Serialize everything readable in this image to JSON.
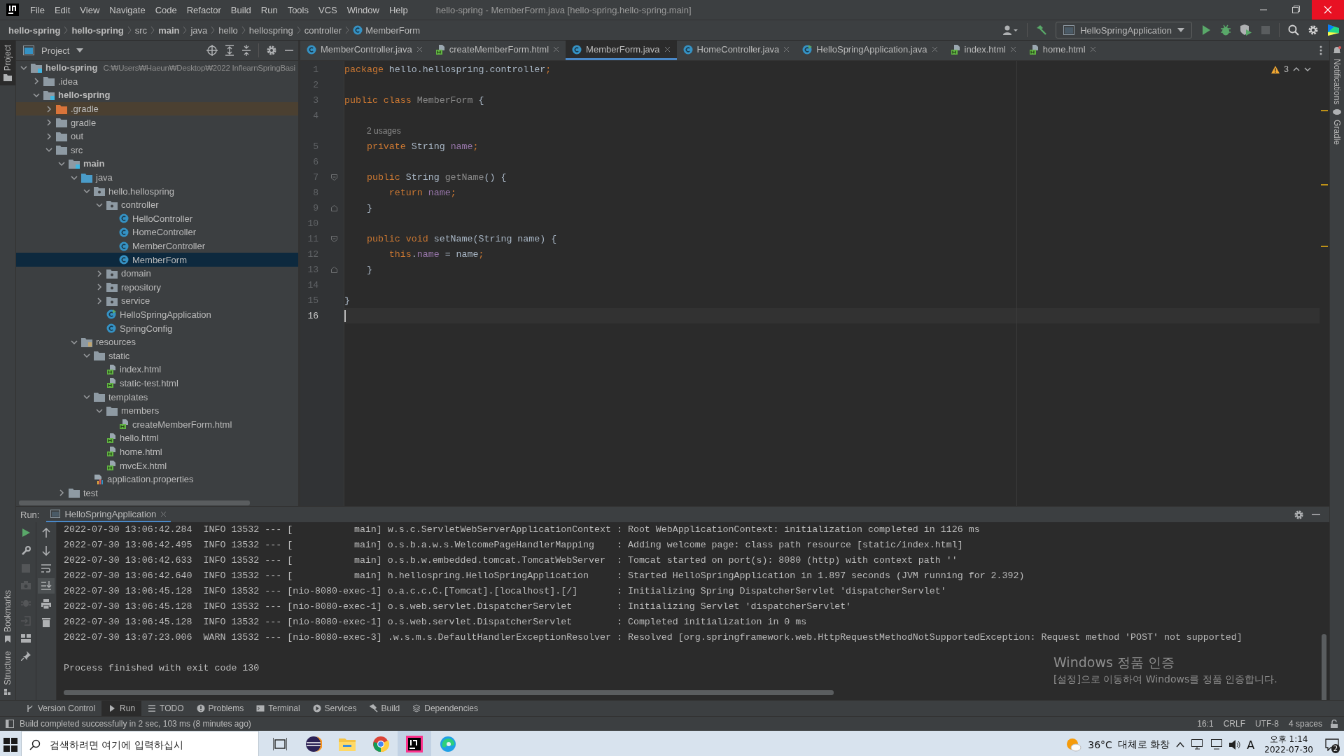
{
  "window": {
    "title": "hello-spring - MemberForm.java [hello-spring.hello-spring.main]",
    "menu": [
      "File",
      "Edit",
      "View",
      "Navigate",
      "Code",
      "Refactor",
      "Build",
      "Run",
      "Tools",
      "VCS",
      "Window",
      "Help"
    ]
  },
  "breadcrumbs": [
    {
      "label": "hello-spring",
      "bold": true,
      "kind": "plain"
    },
    {
      "label": "hello-spring",
      "bold": true,
      "kind": "plain"
    },
    {
      "label": "src",
      "bold": false,
      "kind": "plain"
    },
    {
      "label": "main",
      "bold": true,
      "kind": "plain"
    },
    {
      "label": "java",
      "bold": false,
      "kind": "plain"
    },
    {
      "label": "hello",
      "bold": false,
      "kind": "plain"
    },
    {
      "label": "hellospring",
      "bold": false,
      "kind": "plain"
    },
    {
      "label": "controller",
      "bold": false,
      "kind": "plain"
    },
    {
      "label": "MemberForm",
      "bold": false,
      "kind": "class"
    }
  ],
  "run_config": "HelloSpringApplication",
  "left_stripe": {
    "top": [
      {
        "label": "Project",
        "selected": true
      }
    ],
    "bottom": [
      {
        "label": "Bookmarks",
        "selected": false
      },
      {
        "label": "Structure",
        "selected": false
      }
    ]
  },
  "right_stripe": [
    "Notifications",
    "Gradle"
  ],
  "project_panel": {
    "title": "Project",
    "tree": [
      {
        "label": "hello-spring",
        "path": "C:₩Users₩Haeun₩Desktop₩2022 InflearnSpringBasi",
        "kind": "module",
        "bold": true,
        "expanded": true,
        "selected": false,
        "children": [
          {
            "label": ".idea",
            "kind": "folder",
            "expanded": false,
            "selected": false
          },
          {
            "label": "hello-spring",
            "kind": "module",
            "bold": true,
            "expanded": true,
            "selected": false,
            "children": [
              {
                "label": ".gradle",
                "kind": "excluded",
                "expanded": false,
                "selected": false
              },
              {
                "label": "gradle",
                "kind": "folder",
                "expanded": false,
                "selected": false
              },
              {
                "label": "out",
                "kind": "folder",
                "expanded": false,
                "selected": false
              },
              {
                "label": "src",
                "kind": "folder",
                "expanded": true,
                "selected": false,
                "children": [
                  {
                    "label": "main",
                    "kind": "module",
                    "bold": true,
                    "expanded": true,
                    "selected": false,
                    "children": [
                      {
                        "label": "java",
                        "kind": "source",
                        "expanded": true,
                        "selected": false,
                        "children": [
                          {
                            "label": "hello.hellospring",
                            "kind": "package",
                            "expanded": true,
                            "selected": false,
                            "children": [
                              {
                                "label": "controller",
                                "kind": "package",
                                "expanded": true,
                                "selected": false,
                                "children": [
                                  {
                                    "label": "HelloController",
                                    "kind": "class",
                                    "selected": false
                                  },
                                  {
                                    "label": "HomeController",
                                    "kind": "class",
                                    "selected": false
                                  },
                                  {
                                    "label": "MemberController",
                                    "kind": "class",
                                    "selected": false
                                  },
                                  {
                                    "label": "MemberForm",
                                    "kind": "class",
                                    "selected": true
                                  }
                                ]
                              },
                              {
                                "label": "domain",
                                "kind": "package",
                                "expanded": false,
                                "selected": false
                              },
                              {
                                "label": "repository",
                                "kind": "package",
                                "expanded": false,
                                "selected": false
                              },
                              {
                                "label": "service",
                                "kind": "package",
                                "expanded": false,
                                "selected": false
                              },
                              {
                                "label": "HelloSpringApplication",
                                "kind": "app",
                                "selected": false
                              },
                              {
                                "label": "SpringConfig",
                                "kind": "class",
                                "selected": false
                              }
                            ]
                          }
                        ]
                      },
                      {
                        "label": "resources",
                        "kind": "resources",
                        "expanded": true,
                        "selected": false,
                        "children": [
                          {
                            "label": "static",
                            "kind": "folder",
                            "expanded": true,
                            "selected": false,
                            "children": [
                              {
                                "label": "index.html",
                                "kind": "html",
                                "selected": false
                              },
                              {
                                "label": "static-test.html",
                                "kind": "html",
                                "selected": false
                              }
                            ]
                          },
                          {
                            "label": "templates",
                            "kind": "folder",
                            "expanded": true,
                            "selected": false,
                            "children": [
                              {
                                "label": "members",
                                "kind": "folder",
                                "expanded": true,
                                "selected": false,
                                "children": [
                                  {
                                    "label": "createMemberForm.html",
                                    "kind": "html",
                                    "selected": false
                                  }
                                ]
                              },
                              {
                                "label": "hello.html",
                                "kind": "html",
                                "selected": false
                              },
                              {
                                "label": "home.html",
                                "kind": "html",
                                "selected": false
                              },
                              {
                                "label": "mvcEx.html",
                                "kind": "html",
                                "selected": false
                              }
                            ]
                          },
                          {
                            "label": "application.properties",
                            "kind": "properties",
                            "selected": false
                          }
                        ]
                      }
                    ]
                  },
                  {
                    "label": "test",
                    "kind": "folder",
                    "expanded": false,
                    "selected": false
                  }
                ]
              }
            ]
          }
        ]
      }
    ]
  },
  "editor": {
    "tabs": [
      {
        "label": "MemberController.java",
        "kind": "class",
        "selected": false
      },
      {
        "label": "createMemberForm.html",
        "kind": "html",
        "selected": false
      },
      {
        "label": "MemberForm.java",
        "kind": "class",
        "selected": true
      },
      {
        "label": "HomeController.java",
        "kind": "class",
        "selected": false
      },
      {
        "label": "HelloSpringApplication.java",
        "kind": "app",
        "selected": false
      },
      {
        "label": "index.html",
        "kind": "html",
        "selected": false
      },
      {
        "label": "home.html",
        "kind": "html",
        "selected": false
      }
    ],
    "warnings": "3",
    "lines": [
      {
        "kind": "code",
        "number": "1",
        "current": false,
        "tokens": [
          {
            "kind": "kw",
            "text": "package"
          },
          {
            "kind": "plain",
            "text": " hello.hellospring.controller"
          },
          {
            "kind": "kw",
            "text": ";"
          }
        ]
      },
      {
        "kind": "code",
        "number": "2",
        "current": false
      },
      {
        "kind": "code",
        "number": "3",
        "current": false,
        "tokens": [
          {
            "kind": "kw",
            "text": "public class "
          },
          {
            "kind": "unused",
            "text": "MemberForm"
          },
          {
            "kind": "plain",
            "text": " {"
          }
        ]
      },
      {
        "kind": "code",
        "number": "4",
        "current": false
      },
      {
        "kind": "hint",
        "text": "2 usages"
      },
      {
        "kind": "code",
        "number": "5",
        "current": false,
        "tokens": [
          {
            "kind": "kw",
            "text": "    private "
          },
          {
            "kind": "plain",
            "text": "String "
          },
          {
            "kind": "field",
            "text": "name"
          },
          {
            "kind": "kw",
            "text": ";"
          }
        ]
      },
      {
        "kind": "code",
        "number": "6",
        "current": false
      },
      {
        "kind": "code",
        "number": "7",
        "current": false,
        "fold_start": true,
        "tokens": [
          {
            "kind": "kw",
            "text": "    public "
          },
          {
            "kind": "plain",
            "text": "String "
          },
          {
            "kind": "unused",
            "text": "getName"
          },
          {
            "kind": "plain",
            "text": "() {"
          }
        ]
      },
      {
        "kind": "code",
        "number": "8",
        "current": false,
        "tokens": [
          {
            "kind": "kw",
            "text": "        return "
          },
          {
            "kind": "field",
            "text": "name"
          },
          {
            "kind": "kw",
            "text": ";"
          }
        ]
      },
      {
        "kind": "code",
        "number": "9",
        "current": false,
        "fold_end": true,
        "tokens": [
          {
            "kind": "plain",
            "text": "    }"
          }
        ]
      },
      {
        "kind": "code",
        "number": "10",
        "current": false
      },
      {
        "kind": "code",
        "number": "11",
        "current": false,
        "fold_start": true,
        "tokens": [
          {
            "kind": "kw",
            "text": "    public void "
          },
          {
            "kind": "plain",
            "text": "setName(String name) {"
          }
        ]
      },
      {
        "kind": "code",
        "number": "12",
        "current": false,
        "tokens": [
          {
            "kind": "kw",
            "text": "        this"
          },
          {
            "kind": "plain",
            "text": "."
          },
          {
            "kind": "field",
            "text": "name"
          },
          {
            "kind": "plain",
            "text": " = name"
          },
          {
            "kind": "kw",
            "text": ";"
          }
        ]
      },
      {
        "kind": "code",
        "number": "13",
        "current": false,
        "fold_end": true,
        "tokens": [
          {
            "kind": "plain",
            "text": "    }"
          }
        ]
      },
      {
        "kind": "code",
        "number": "14",
        "current": false
      },
      {
        "kind": "code",
        "number": "15",
        "current": false,
        "tokens": [
          {
            "kind": "plain",
            "text": "}"
          }
        ]
      },
      {
        "kind": "code",
        "number": "16",
        "current": true
      }
    ]
  },
  "run_panel": {
    "label": "Run:",
    "tab": "HelloSpringApplication",
    "log": [
      "2022-07-30 13:06:42.284  INFO 13532 --- [           main] w.s.c.ServletWebServerApplicationContext : Root WebApplicationContext: initialization completed in 1126 ms",
      "2022-07-30 13:06:42.495  INFO 13532 --- [           main] o.s.b.a.w.s.WelcomePageHandlerMapping    : Adding welcome page: class path resource [static/index.html]",
      "2022-07-30 13:06:42.633  INFO 13532 --- [           main] o.s.b.w.embedded.tomcat.TomcatWebServer  : Tomcat started on port(s): 8080 (http) with context path ''",
      "2022-07-30 13:06:42.640  INFO 13532 --- [           main] h.hellospring.HelloSpringApplication     : Started HelloSpringApplication in 1.897 seconds (JVM running for 2.392)",
      "2022-07-30 13:06:45.128  INFO 13532 --- [nio-8080-exec-1] o.a.c.c.C.[Tomcat].[localhost].[/]       : Initializing Spring DispatcherServlet 'dispatcherServlet'",
      "2022-07-30 13:06:45.128  INFO 13532 --- [nio-8080-exec-1] o.s.web.servlet.DispatcherServlet        : Initializing Servlet 'dispatcherServlet'",
      "2022-07-30 13:06:45.128  INFO 13532 --- [nio-8080-exec-1] o.s.web.servlet.DispatcherServlet        : Completed initialization in 0 ms",
      "2022-07-30 13:07:23.006  WARN 13532 --- [nio-8080-exec-3] .w.s.m.s.DefaultHandlerExceptionResolver : Resolved [org.springframework.web.HttpRequestMethodNotSupportedException: Request method 'POST' not supported]"
    ],
    "exit": "Process finished with exit code 130"
  },
  "tool_tabs": [
    {
      "label": "Version Control",
      "kind": "vcs",
      "selected": false
    },
    {
      "label": "Run",
      "kind": "run",
      "selected": true
    },
    {
      "label": "TODO",
      "kind": "todo",
      "selected": false
    },
    {
      "label": "Problems",
      "kind": "problems",
      "selected": false
    },
    {
      "label": "Terminal",
      "kind": "terminal",
      "selected": false
    },
    {
      "label": "Services",
      "kind": "services",
      "selected": false
    },
    {
      "label": "Build",
      "kind": "build",
      "selected": false
    },
    {
      "label": "Dependencies",
      "kind": "dependencies",
      "selected": false
    }
  ],
  "status_bar": {
    "message": "Build completed successfully in 2 sec, 103 ms (8 minutes ago)",
    "position": "16:1",
    "line_separator": "CRLF",
    "encoding": "UTF-8",
    "indent": "4 spaces"
  },
  "activation": {
    "title": "Windows 정품 인증",
    "text": "[설정]으로 이동하여 Windows를 정품 인증합니다."
  },
  "taskbar": {
    "search_placeholder": "검색하려면 여기에 입력하십시",
    "apps": [
      {
        "kind": "taskview",
        "selected": false
      },
      {
        "kind": "eclipse",
        "selected": false
      },
      {
        "kind": "explorer",
        "selected": false
      },
      {
        "kind": "chrome",
        "selected": false
      },
      {
        "kind": "intellij",
        "selected": true
      },
      {
        "kind": "edge",
        "selected": false
      }
    ],
    "weather": "36°C",
    "weather_text": "대체로 화창",
    "ime": "A",
    "time": "오후 1:14",
    "date": "2022-07-30",
    "notifications": "2"
  }
}
